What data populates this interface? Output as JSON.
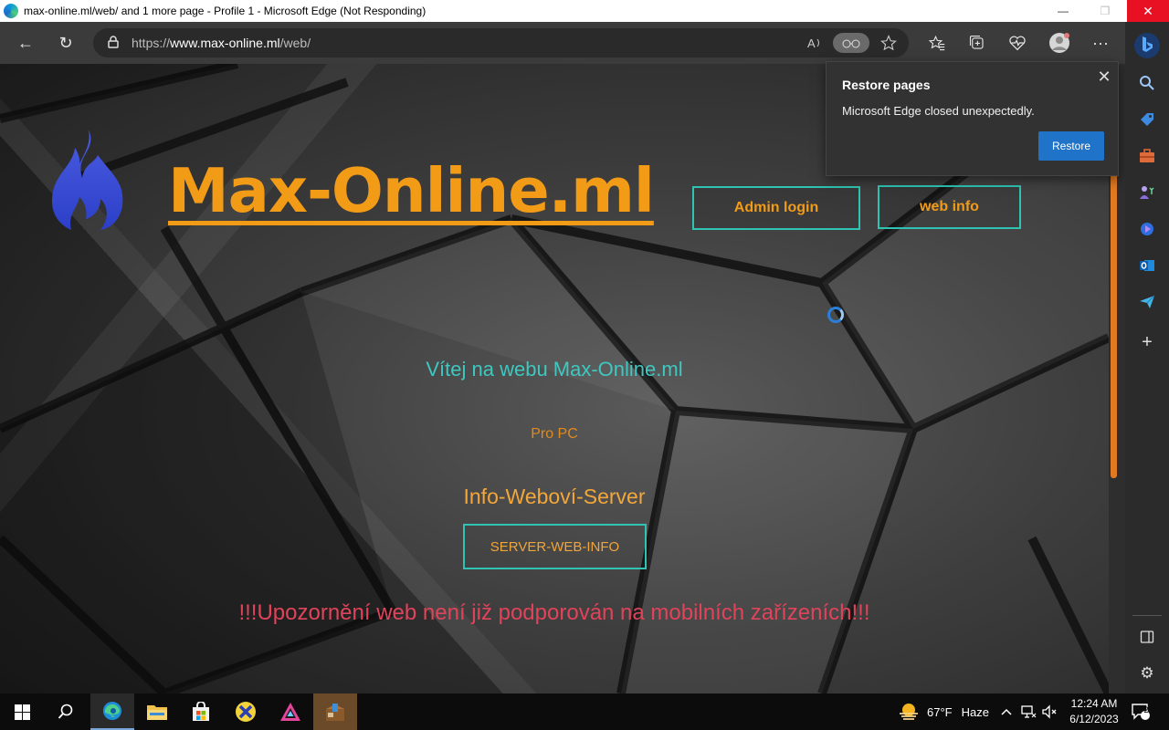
{
  "window": {
    "title": "max-online.ml/web/ and 1 more page - Profile 1 - Microsoft Edge (Not Responding)",
    "minimize_icon": "—",
    "maximize_icon": "❐",
    "close_icon": "✕"
  },
  "toolbar": {
    "back_icon": "←",
    "refresh_icon": "↻",
    "lock_icon": "🔒",
    "url_scheme": "https://",
    "url_host": "www.max-online.ml",
    "url_path": "/web/",
    "read_aloud_icon": "Aˀ",
    "read_pill": "ꔰ",
    "favorite_icon": "☆",
    "favorites_icon": "✩",
    "collections_icon": "⧉",
    "health_icon": "♡",
    "profile_icon": "●",
    "more_icon": "···"
  },
  "sidebar": {
    "bing_icon": "b",
    "items": [
      "🔍",
      "🏷",
      "🧰",
      "♟",
      "◉",
      "O",
      "✈",
      "+"
    ],
    "split_icon": "▯",
    "settings_icon": "⚙"
  },
  "page": {
    "brand": "Max-Online.ml",
    "nav": {
      "admin_label": "Admin login",
      "info_label": "web info"
    },
    "welcome": "Vítej na webu Max-Online.ml",
    "for_pc": "Pro PC",
    "info_server": "Info-Weboví-Server",
    "server_button": "SERVER-WEB-INFO",
    "warning": "!!!Upozornění web není již podporován na mobilních zařízeních!!!",
    "accent_colors": {
      "orange": "#f29b17",
      "teal": "#3ec8c0",
      "red": "#e0435a"
    }
  },
  "restore_popup": {
    "title": "Restore pages",
    "message": "Microsoft Edge closed unexpectedly.",
    "restore_label": "Restore",
    "close_icon": "✕"
  },
  "taskbar": {
    "start_icon": "⊞",
    "search_icon": "⌕",
    "apps": [
      "edge",
      "file-explorer",
      "store",
      "xbox-app",
      "triangle-app",
      "package-app"
    ],
    "weather_temp": "67°F",
    "weather_cond": "Haze",
    "chevron": "^",
    "time": "12:24 AM",
    "date": "6/12/2023",
    "notif_count": "2"
  }
}
